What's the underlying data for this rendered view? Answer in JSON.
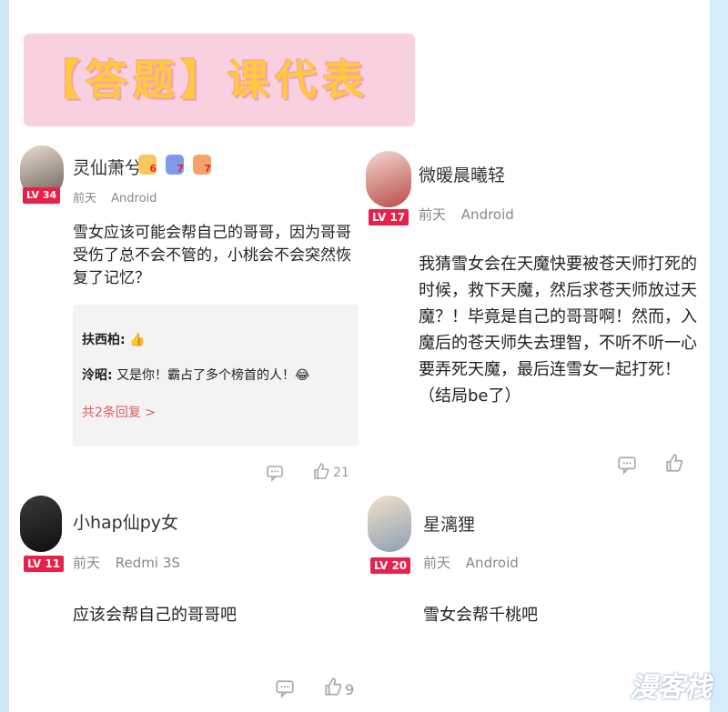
{
  "title": "【答题】课代表",
  "comments": [
    {
      "username": "灵仙萧兮",
      "level": "LV 34",
      "time": "前天",
      "device": "Android",
      "badges": [
        "6",
        "7",
        "7"
      ],
      "text": "雪女应该可能会帮自己的哥哥，因为哥哥受伤了总不会不管的，小桃会不会突然恢复了记忆？",
      "replies": [
        {
          "user": "扶西柏:",
          "text": "👍"
        },
        {
          "user": "泠昭:",
          "text": "又是你！霸占了多个榜首的人！😂"
        }
      ],
      "more_replies": "共2条回复 >",
      "likes": "21"
    },
    {
      "username": "微暖晨曦轻",
      "level": "LV 17",
      "time": "前天",
      "device": "Android",
      "text": "我猜雪女会在天魔快要被苍天师打死的时候，救下天魔，然后求苍天师放过天魔？！毕竟是自己的哥哥啊！然而，入魔后的苍天师失去理智，不听不听一心要弄死天魔，最后连雪女一起打死！（结局be了）",
      "likes": ""
    },
    {
      "username": "小hap仙py女",
      "level": "LV 11",
      "time": "前天",
      "device": "Redmi 3S",
      "text": "应该会帮自己的哥哥吧",
      "likes": "9"
    },
    {
      "username": "星漓狸",
      "level": "LV 20",
      "time": "前天",
      "device": "Android",
      "text": "雪女会帮千桃吧",
      "likes": ""
    }
  ],
  "watermark": "漫客栈"
}
